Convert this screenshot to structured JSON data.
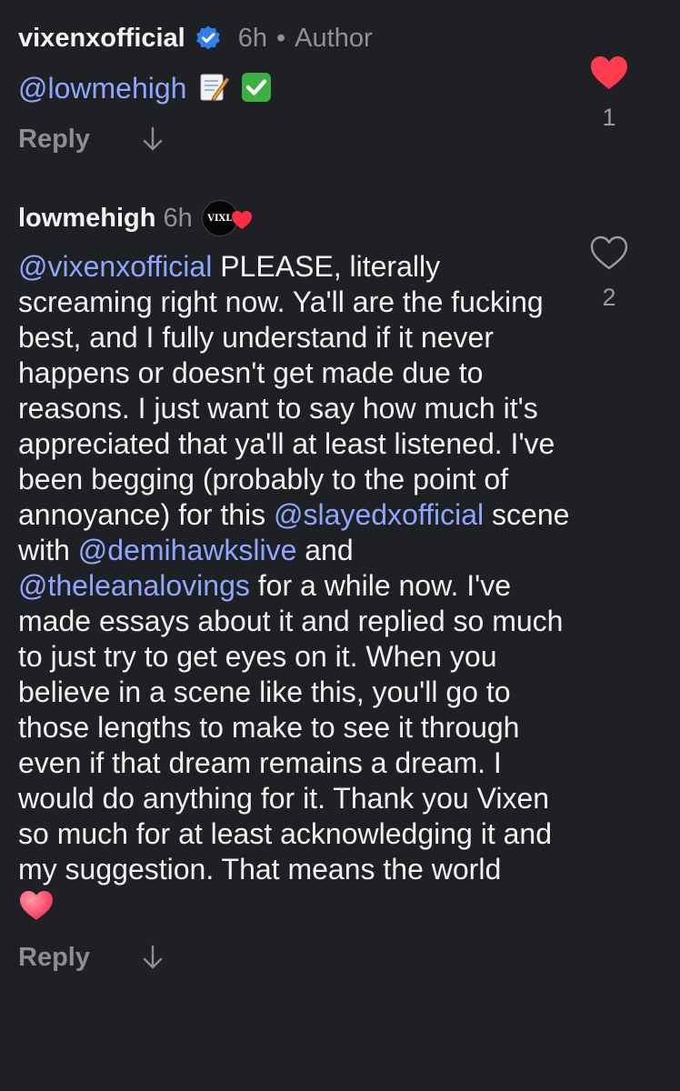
{
  "comments": [
    {
      "username": "vixenxofficial",
      "verified": true,
      "time": "6h",
      "separator": "•",
      "role": "Author",
      "mention": "@lowmehigh",
      "emojis": [
        "memo-emoji",
        "check-mark-emoji"
      ],
      "reply_label": "Reply",
      "likes": "1",
      "liked": true
    },
    {
      "username": "lowmehigh",
      "time": "6h",
      "badge_text": "VIXL",
      "reply_label": "Reply",
      "likes": "2",
      "liked": false,
      "segments": {
        "m1": "@vixenxofficial",
        "t1": " PLEASE, literally screaming right now. Ya'll are the fucking best, and I fully understand if it never happens or doesn't get made due to reasons. I just want to say how much it's appreciated that ya'll at least listened. I've been begging (probably to the point of annoyance) for this ",
        "m2": "@slayedxofficial",
        "t2": " scene with ",
        "m3": "@demihawkslive",
        "t3": " and ",
        "m4": "@theleanalovings",
        "t4": " for a while now. I've made essays about it and replied so much to just try to get eyes on it. When you believe in a scene like this, you'll go to those lengths to make to see it through even if that dream remains a dream. I would do anything for it. Thank you Vixen so much for at least acknowledging it and my suggestion. That means the world"
      }
    }
  ],
  "colors": {
    "background": "#1f2023",
    "mention": "#8fa6ff",
    "muted": "#8f9196",
    "like_red": "#ff3b4f",
    "verified_blue": "#2f80ed"
  }
}
